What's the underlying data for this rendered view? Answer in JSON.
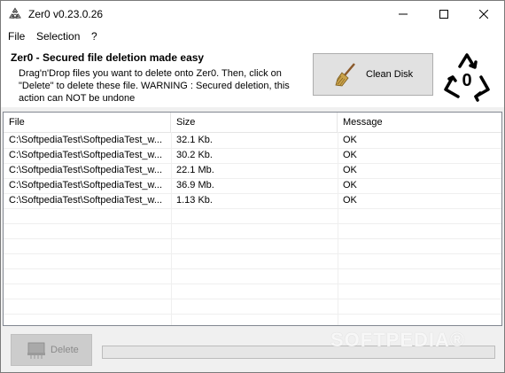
{
  "window": {
    "title": "Zer0 v0.23.0.26"
  },
  "menu": [
    "File",
    "Selection",
    "?"
  ],
  "header": {
    "title": "Zer0 - Secured file deletion made easy",
    "description": "Drag'n'Drop files you want to delete onto Zer0. Then, click on \"Delete\" to delete these file. WARNING : Secured deletion, this action can NOT be undone",
    "clean_button_label": "Clean Disk",
    "logo_digit": "0"
  },
  "table": {
    "columns": [
      "File",
      "Size",
      "Message"
    ],
    "rows": [
      [
        "C:\\SoftpediaTest\\SoftpediaTest_w...",
        "32.1 Kb.",
        "OK"
      ],
      [
        "C:\\SoftpediaTest\\SoftpediaTest_w...",
        "30.2 Kb.",
        "OK"
      ],
      [
        "C:\\SoftpediaTest\\SoftpediaTest_w...",
        "22.1 Mb.",
        "OK"
      ],
      [
        "C:\\SoftpediaTest\\SoftpediaTest_w...",
        "36.9 Mb.",
        "OK"
      ],
      [
        "C:\\SoftpediaTest\\SoftpediaTest_w...",
        "1.13 Kb.",
        "OK"
      ]
    ]
  },
  "footer": {
    "delete_label": "Delete",
    "progress": 0,
    "watermark": "SOFTPEDIA®"
  },
  "colors": {
    "progress_fill": "#06b025",
    "close_hover": "#e81123"
  }
}
